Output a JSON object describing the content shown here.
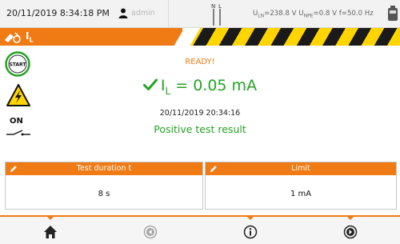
{
  "topbar": {
    "datetime": "20/11/2019 8:34:18 PM",
    "user": "admin",
    "meas_uln_label": "U",
    "meas_uln_sub": "LN",
    "meas_uln_value": "=238.8 V",
    "meas_upe_label": "U",
    "meas_upe_sub": "NPE",
    "meas_upe_value": "=0.8 V",
    "meas_freq": "f=50.0 Hz",
    "nl_label": "N L"
  },
  "hazard": {
    "mode_symbol": "I",
    "mode_sub": "L"
  },
  "left": {
    "start_label": "START",
    "on_label": "ON"
  },
  "main": {
    "status": "READY!",
    "result_symbol": "I",
    "result_sub": "L",
    "result_value": " = 0.05 mA",
    "timestamp": "20/11/2019 20:34:16",
    "verdict": "Positive test result"
  },
  "panels": [
    {
      "title": "Test duration t",
      "value": "8 s"
    },
    {
      "title": "Limit",
      "value": "1 mA"
    }
  ],
  "nav": [
    {
      "icon": "home-icon",
      "enabled": true
    },
    {
      "icon": "back-icon",
      "enabled": false
    },
    {
      "icon": "info-icon",
      "enabled": true
    },
    {
      "icon": "forward-icon",
      "enabled": true
    }
  ],
  "colors": {
    "accent": "#f07b14",
    "ok_green": "#23a323",
    "hazard_yellow": "#ffd500"
  }
}
